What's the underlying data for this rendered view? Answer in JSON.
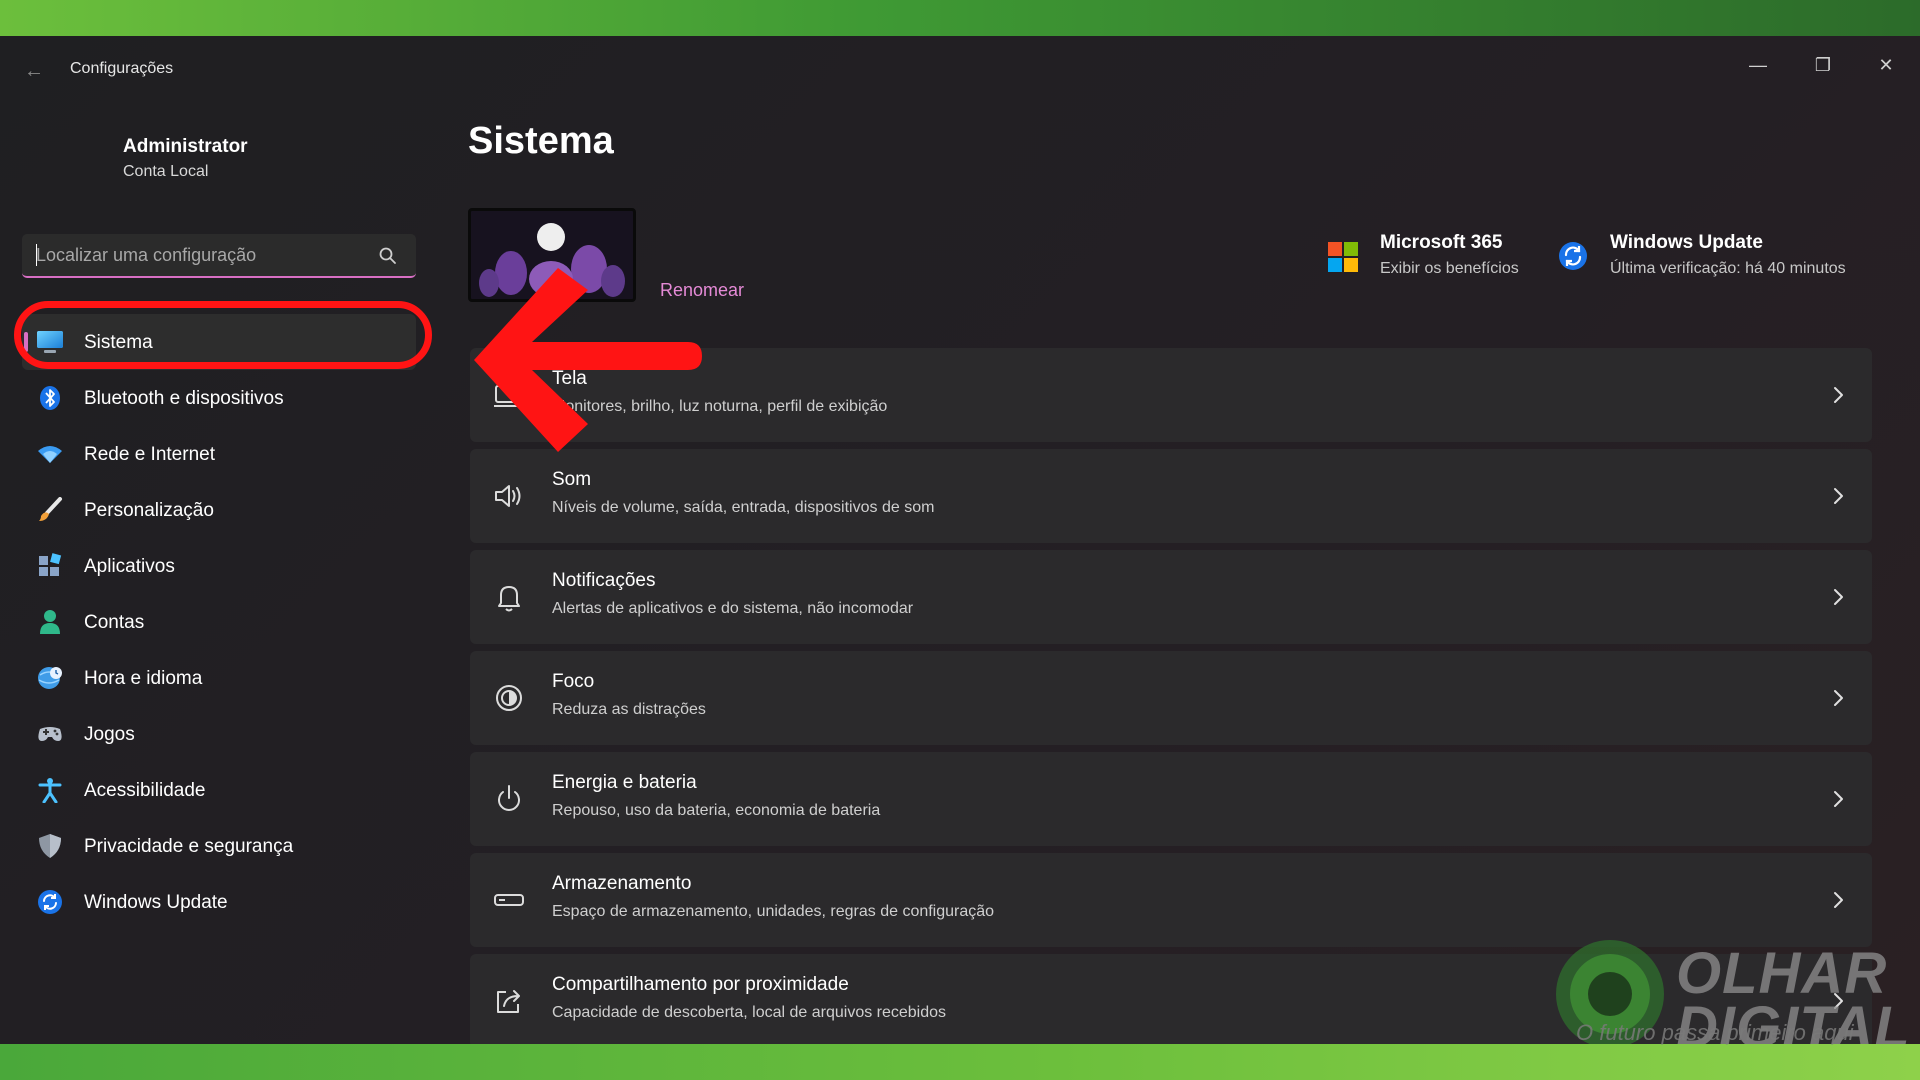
{
  "window": {
    "title": "Configurações",
    "back_glyph": "←",
    "controls": {
      "minimize": "—",
      "maximize": "❐",
      "close": "✕"
    }
  },
  "account": {
    "name": "Administrator",
    "type": "Conta Local"
  },
  "search": {
    "placeholder": "Localizar uma configuração",
    "icon": "search-icon"
  },
  "sidebar": {
    "accent": "#d86fc4",
    "items": [
      {
        "label": "Sistema",
        "icon": "monitor-icon",
        "selected": true
      },
      {
        "label": "Bluetooth e dispositivos",
        "icon": "bluetooth-icon"
      },
      {
        "label": "Rede e Internet",
        "icon": "wifi-icon"
      },
      {
        "label": "Personalização",
        "icon": "brush-icon"
      },
      {
        "label": "Aplicativos",
        "icon": "apps-icon"
      },
      {
        "label": "Contas",
        "icon": "person-icon"
      },
      {
        "label": "Hora e idioma",
        "icon": "globe-clock-icon"
      },
      {
        "label": "Jogos",
        "icon": "gamepad-icon"
      },
      {
        "label": "Acessibilidade",
        "icon": "accessibility-icon"
      },
      {
        "label": "Privacidade e segurança",
        "icon": "shield-icon"
      },
      {
        "label": "Windows Update",
        "icon": "windows-update-icon"
      }
    ]
  },
  "main": {
    "title": "Sistema",
    "rename_label": "Renomear",
    "promos": [
      {
        "title": "Microsoft 365",
        "subtitle": "Exibir os benefícios",
        "icon": "microsoft-logo-icon"
      },
      {
        "title": "Windows Update",
        "subtitle": "Última verificação: há 40 minutos",
        "icon": "windows-update-icon"
      }
    ],
    "cards": [
      {
        "title": "Tela",
        "subtitle": "Monitores, brilho, luz noturna, perfil de exibição",
        "icon": "display-icon"
      },
      {
        "title": "Som",
        "subtitle": "Níveis de volume, saída, entrada, dispositivos de som",
        "icon": "speaker-icon"
      },
      {
        "title": "Notificações",
        "subtitle": "Alertas de aplicativos e do sistema, não incomodar",
        "icon": "bell-icon"
      },
      {
        "title": "Foco",
        "subtitle": "Reduza as distrações",
        "icon": "focus-icon"
      },
      {
        "title": "Energia e bateria",
        "subtitle": "Repouso, uso da bateria, economia de bateria",
        "icon": "power-icon"
      },
      {
        "title": "Armazenamento",
        "subtitle": "Espaço de armazenamento, unidades, regras de configuração",
        "icon": "storage-icon"
      },
      {
        "title": "Compartilhamento por proximidade",
        "subtitle": "Capacidade de descoberta, local de arquivos recebidos",
        "icon": "share-icon"
      }
    ]
  },
  "watermark": {
    "brand_line1": "OLHAR",
    "brand_line2": "DIGITAL",
    "tagline": "O futuro passa primeiro aqui"
  },
  "annotation": {
    "color": "#ff1414"
  }
}
